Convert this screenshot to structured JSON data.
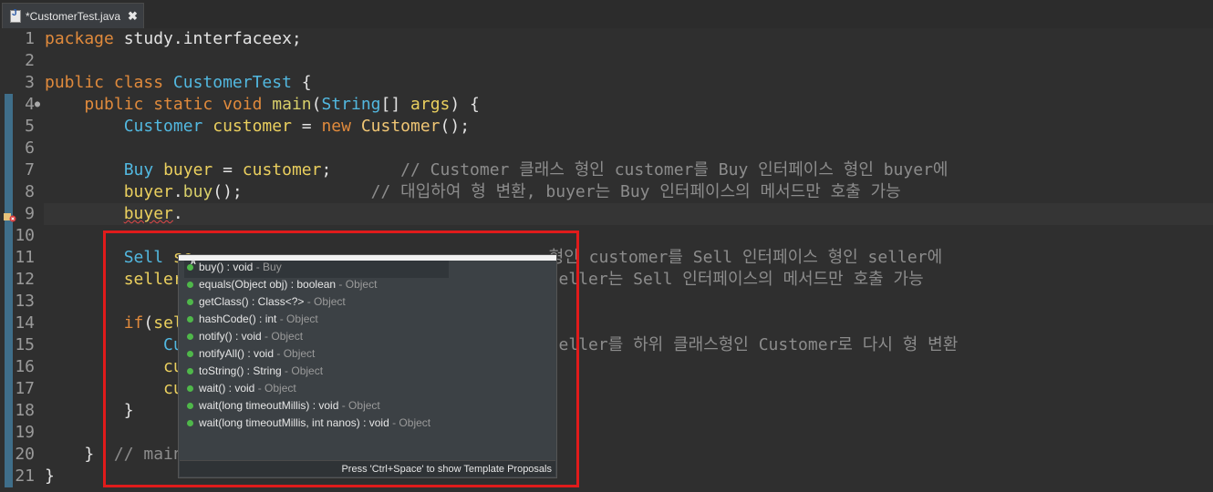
{
  "tab": {
    "icon": "java-file-icon",
    "title": "*CustomerTest.java",
    "close": "✖"
  },
  "lines": [
    {
      "n": "1",
      "tokens": [
        [
          "kw",
          "package "
        ],
        [
          "df",
          "study.interfaceex;"
        ]
      ]
    },
    {
      "n": "2",
      "tokens": []
    },
    {
      "n": "3",
      "tokens": [
        [
          "kw",
          "public class "
        ],
        [
          "ty",
          "CustomerTest"
        ],
        [
          "df",
          " {"
        ]
      ]
    },
    {
      "n": "4",
      "tokens": [
        [
          "df",
          "    "
        ],
        [
          "kw",
          "public static void "
        ],
        [
          "fn",
          "main"
        ],
        [
          "df",
          "("
        ],
        [
          "ty",
          "String"
        ],
        [
          "df",
          "[] "
        ],
        [
          "var",
          "args"
        ],
        [
          "df",
          ") {"
        ]
      ]
    },
    {
      "n": "5",
      "tokens": [
        [
          "df",
          "        "
        ],
        [
          "ty",
          "Customer "
        ],
        [
          "var",
          "customer"
        ],
        [
          "df",
          " = "
        ],
        [
          "kw",
          "new "
        ],
        [
          "cls",
          "Customer"
        ],
        [
          "df",
          "();"
        ]
      ]
    },
    {
      "n": "6",
      "tokens": []
    },
    {
      "n": "7",
      "tokens": [
        [
          "df",
          "        "
        ],
        [
          "ty",
          "Buy "
        ],
        [
          "var",
          "buyer"
        ],
        [
          "df",
          " = "
        ],
        [
          "var",
          "customer"
        ],
        [
          "df",
          ";       "
        ],
        [
          "cm",
          "// Customer 클래스 형인 customer를 Buy 인터페이스 형인 buyer에"
        ]
      ]
    },
    {
      "n": "8",
      "tokens": [
        [
          "df",
          "        "
        ],
        [
          "var",
          "buyer"
        ],
        [
          "df",
          "."
        ],
        [
          "fn",
          "buy"
        ],
        [
          "df",
          "();             "
        ],
        [
          "cm",
          "// 대입하여 형 변환, buyer는 Buy 인터페이스의 메서드만 호출 가능"
        ]
      ]
    },
    {
      "n": "9",
      "tokens": [
        [
          "df",
          "        "
        ],
        [
          "var",
          "buyer"
        ],
        [
          "df",
          "."
        ]
      ]
    },
    {
      "n": "10",
      "tokens": []
    },
    {
      "n": "11",
      "tokens": [
        [
          "df",
          "        "
        ],
        [
          "ty",
          "Sell "
        ],
        [
          "var",
          "se"
        ],
        [
          "df",
          "                                    "
        ],
        [
          "cm",
          "형인 customer를 Sell 인터페이스 형인 seller에"
        ]
      ]
    },
    {
      "n": "12",
      "tokens": [
        [
          "df",
          "        "
        ],
        [
          "var",
          "seller"
        ],
        [
          "df",
          ".                                    "
        ],
        [
          "cm",
          "seller는 Sell 인터페이스의 메서드만 호출 가능"
        ]
      ]
    },
    {
      "n": "13",
      "tokens": []
    },
    {
      "n": "14",
      "tokens": [
        [
          "df",
          "        "
        ],
        [
          "kw",
          "if"
        ],
        [
          "df",
          "("
        ],
        [
          "var",
          "sell"
        ]
      ]
    },
    {
      "n": "15",
      "tokens": [
        [
          "df",
          "            "
        ],
        [
          "ty",
          "Cus"
        ],
        [
          "df",
          "                                     "
        ],
        [
          "cm",
          "eller를 하위 클래스형인 Customer로 다시 형 변환"
        ]
      ]
    },
    {
      "n": "16",
      "tokens": [
        [
          "df",
          "            "
        ],
        [
          "var",
          "cus"
        ]
      ]
    },
    {
      "n": "17",
      "tokens": [
        [
          "df",
          "            "
        ],
        [
          "var",
          "cus"
        ]
      ]
    },
    {
      "n": "18",
      "tokens": [
        [
          "df",
          "        }"
        ]
      ]
    },
    {
      "n": "19",
      "tokens": []
    },
    {
      "n": "20",
      "tokens": [
        [
          "df",
          "    }  "
        ],
        [
          "cm",
          "// main"
        ]
      ]
    },
    {
      "n": "21",
      "tokens": [
        [
          "df",
          "}"
        ]
      ]
    }
  ],
  "popup": {
    "proposals": [
      {
        "sig": "buy() : void",
        "owner": " - Buy",
        "selected": true
      },
      {
        "sig": "equals(Object obj) : boolean",
        "owner": " - Object"
      },
      {
        "sig": "getClass() : Class<?>",
        "owner": " - Object"
      },
      {
        "sig": "hashCode() : int",
        "owner": " - Object"
      },
      {
        "sig": "notify() : void",
        "owner": " - Object"
      },
      {
        "sig": "notifyAll() : void",
        "owner": " - Object"
      },
      {
        "sig": "toString() : String",
        "owner": " - Object"
      },
      {
        "sig": "wait() : void",
        "owner": " - Object"
      },
      {
        "sig": "wait(long timeoutMillis) : void",
        "owner": " - Object"
      },
      {
        "sig": "wait(long timeoutMillis, int nanos) : void",
        "owner": " - Object"
      }
    ],
    "abstract_badge": "A",
    "footer": "Press 'Ctrl+Space' to show Template Proposals"
  },
  "colors": {
    "highlight_box": "#e01b1b",
    "keyword": "#e08a3c",
    "type": "#52b8e0",
    "comment": "#8c8c8c"
  }
}
